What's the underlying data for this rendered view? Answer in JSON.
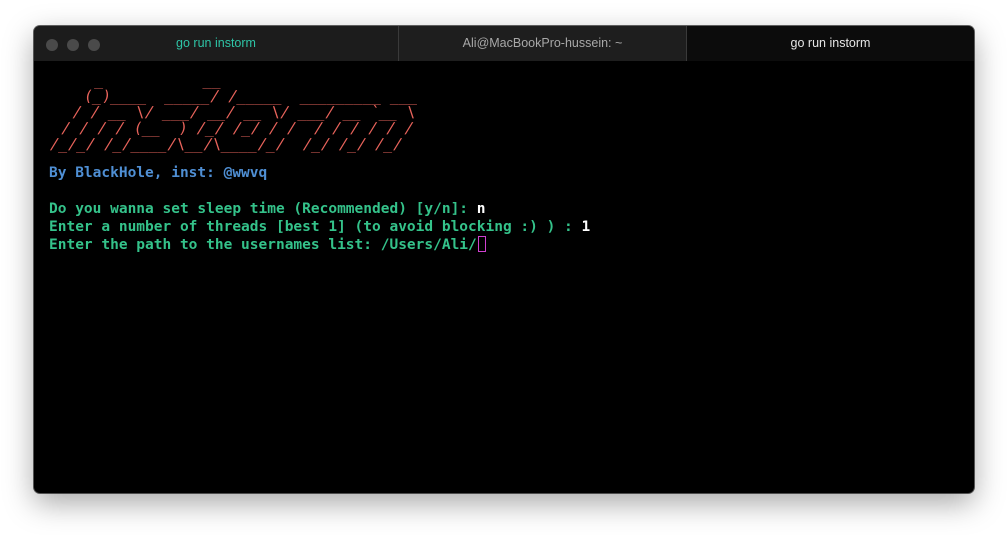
{
  "tabs": [
    {
      "label": "go run instorm"
    },
    {
      "label": "Ali@MacBookPro-hussein: ~"
    },
    {
      "label": "go run instorm"
    }
  ],
  "terminal": {
    "banner_lines": [
      "    _           __",
      "   (_)____  _____/ /_____  _________ ___",
      "  / / __ \\/ ___/ __/ __ \\/ ___/ __ `__ \\",
      " / / / / (__  ) /_/ /_/ / /  / / / / / /",
      "/_/_/ /_/____/\\__/\\____/_/  /_/ /_/ /_/"
    ],
    "byline": "By BlackHole, inst: @wwvq",
    "prompt1": "Do you wanna set sleep time (Recommended) [y/n]: ",
    "answer1": "n",
    "prompt2": "Enter a number of threads [best 1] (to avoid blocking :) ) : ",
    "answer2": "1",
    "prompt3": "Enter the path to the usernames list: ",
    "input3": "/Users/Ali/"
  },
  "colors": {
    "banner": "#e8635b",
    "byline": "#4f8fd4",
    "prompt": "#34c28a",
    "answer": "#ffffff",
    "cursor": "#d040d0",
    "active_tab_text": "#2ec4a6"
  }
}
